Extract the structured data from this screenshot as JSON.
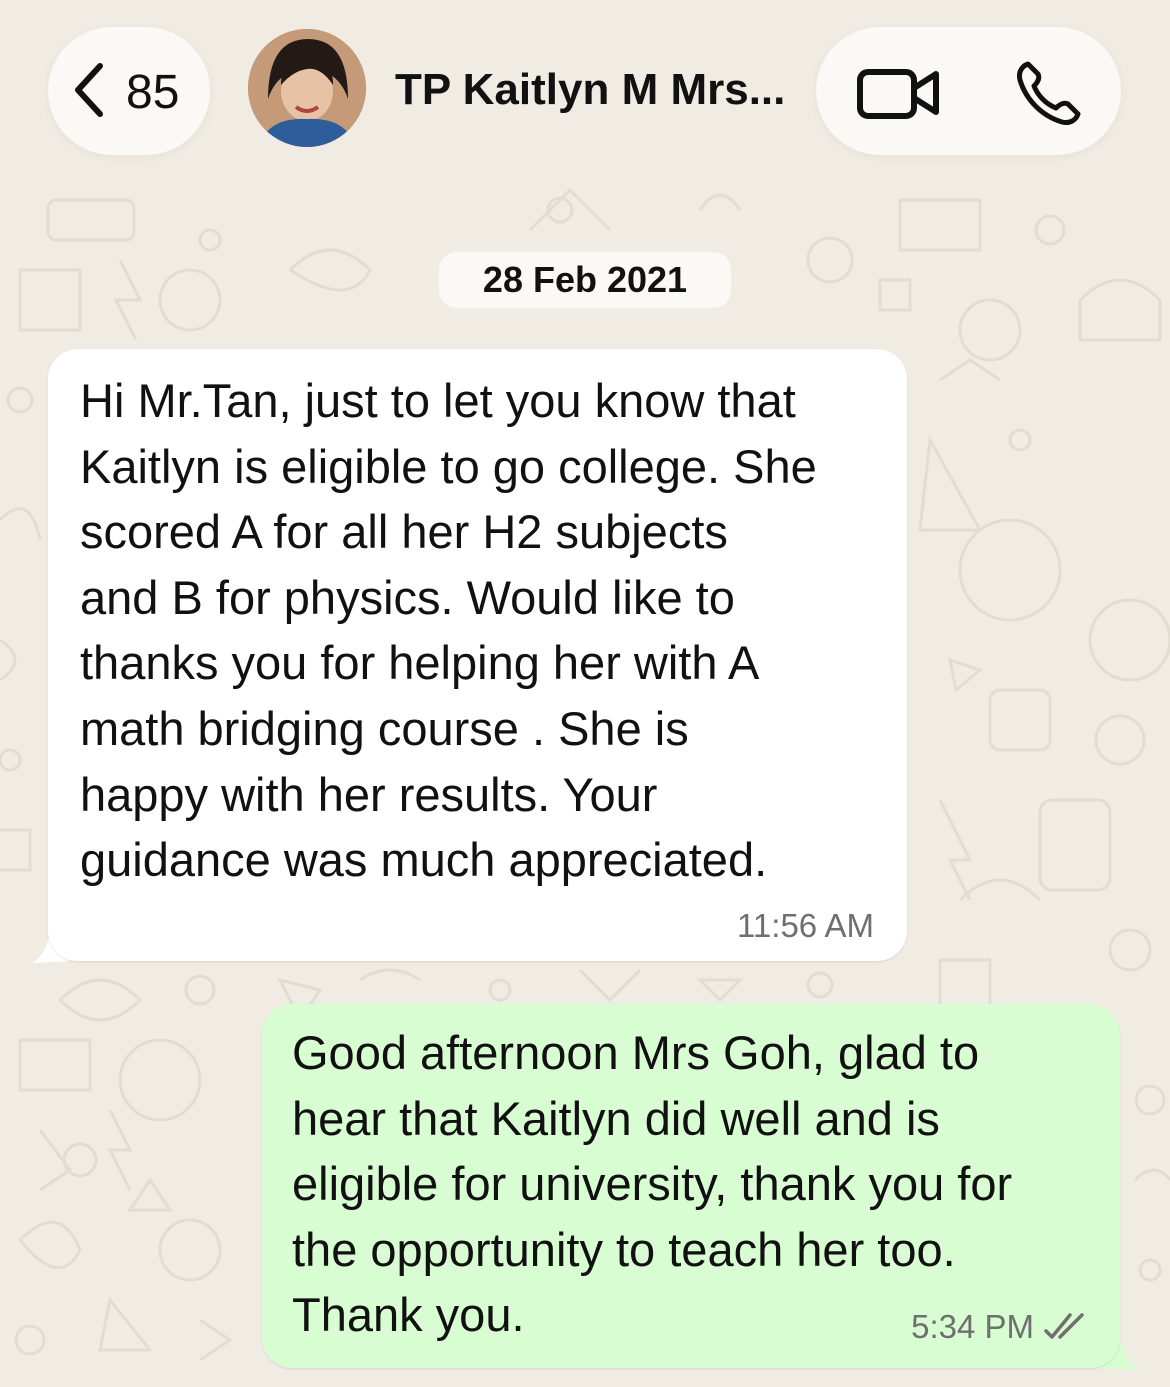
{
  "header": {
    "back_count": "85",
    "contact_name": "TP Kaitlyn M Mrs...",
    "icons": [
      "chevron-left-icon",
      "video-call-icon",
      "phone-call-icon"
    ]
  },
  "chat": {
    "date_chip": "28 Feb 2021",
    "messages": [
      {
        "direction": "incoming",
        "text": "Hi Mr.Tan, just to let you know that\nKaitlyn is eligible to go college. She\nscored A for all her H2 subjects\nand B for physics. Would like to\nthanks you for helping her with A\nmath bridging course . She is\nhappy with her results. Your\nguidance was much appreciated.",
        "time": "11:56 AM"
      },
      {
        "direction": "outgoing",
        "text": "Good afternoon Mrs Goh, glad to\nhear that Kaitlyn did well and is\neligible for university, thank you for\nthe opportunity to teach her too.\nThank you.",
        "time": "5:34 PM",
        "status_icon": "read-double-check-icon"
      }
    ]
  },
  "colors": {
    "background": "#f1ece3",
    "incoming_bubble": "#ffffff",
    "outgoing_bubble": "#d8fdd2",
    "pill": "#fbf9f5",
    "read_ticks": "#6f6f6f"
  }
}
